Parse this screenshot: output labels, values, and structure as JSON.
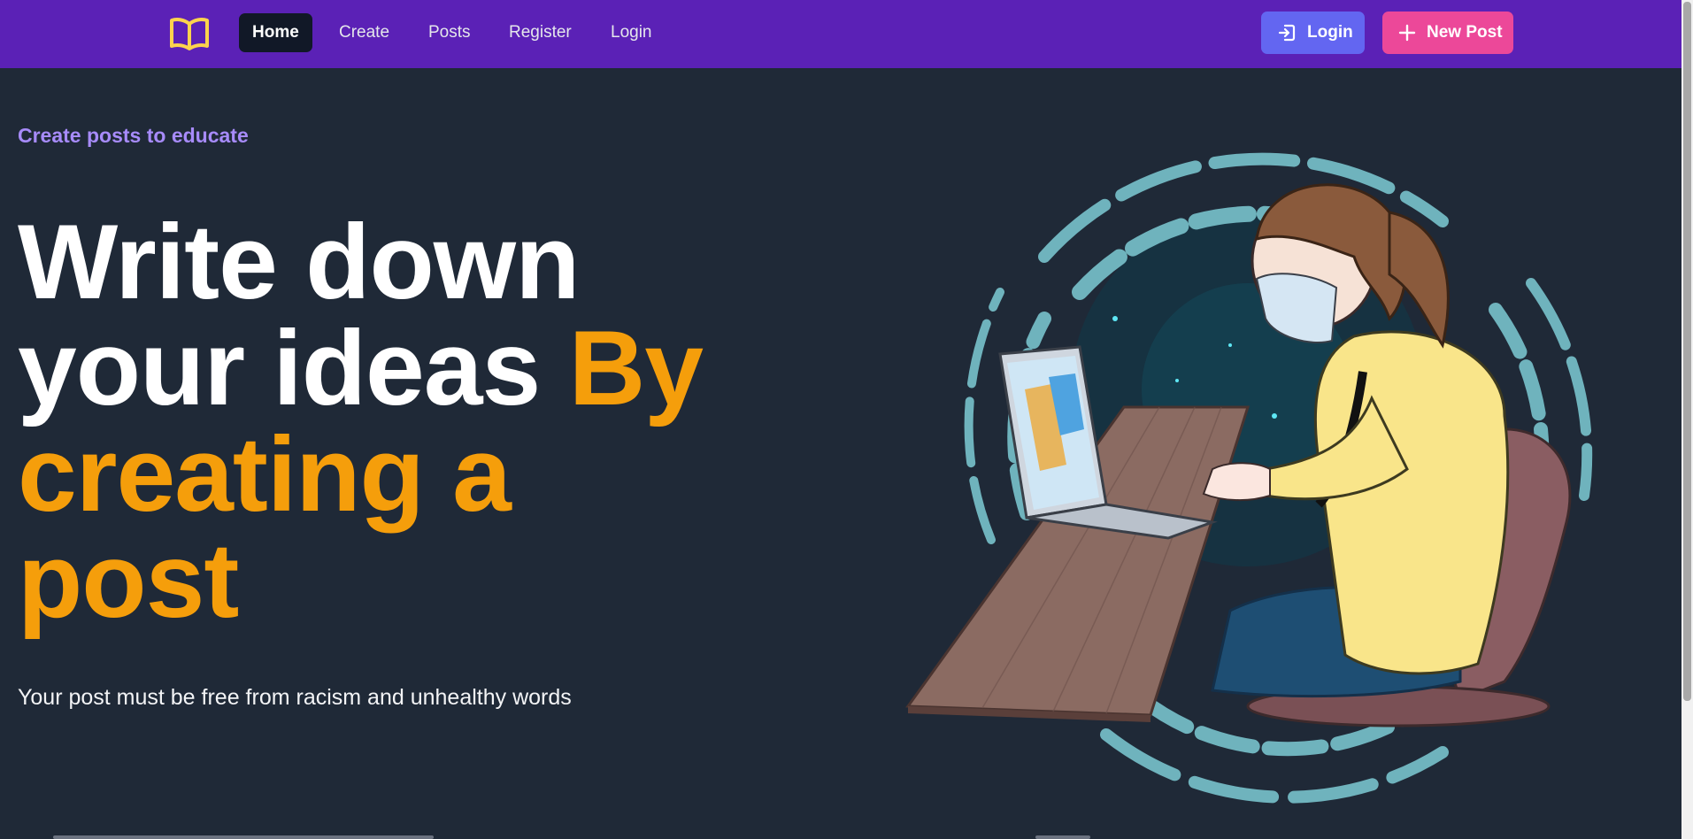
{
  "navbar": {
    "logo_icon": "open-book-icon",
    "links": [
      {
        "label": "Home",
        "active": true
      },
      {
        "label": "Create",
        "active": false
      },
      {
        "label": "Posts",
        "active": false
      },
      {
        "label": "Register",
        "active": false
      },
      {
        "label": "Login",
        "active": false
      }
    ],
    "login_button": {
      "label": "Login",
      "icon": "sign-in-icon"
    },
    "new_post_button": {
      "label": "New Post",
      "icon": "plus-icon"
    }
  },
  "hero": {
    "eyebrow": "Create posts to educate",
    "headline_part1": "Write down your ideas ",
    "headline_part2": "By creating a post",
    "subtitle": "Your post must be free from racism and unhealthy words"
  },
  "colors": {
    "navbar": "#5b21b6",
    "background": "#1f2937",
    "accent": "#f59e0b",
    "eyebrow": "#a78bfa",
    "login_button": "#6366f1",
    "new_post_button": "#ec4899"
  }
}
